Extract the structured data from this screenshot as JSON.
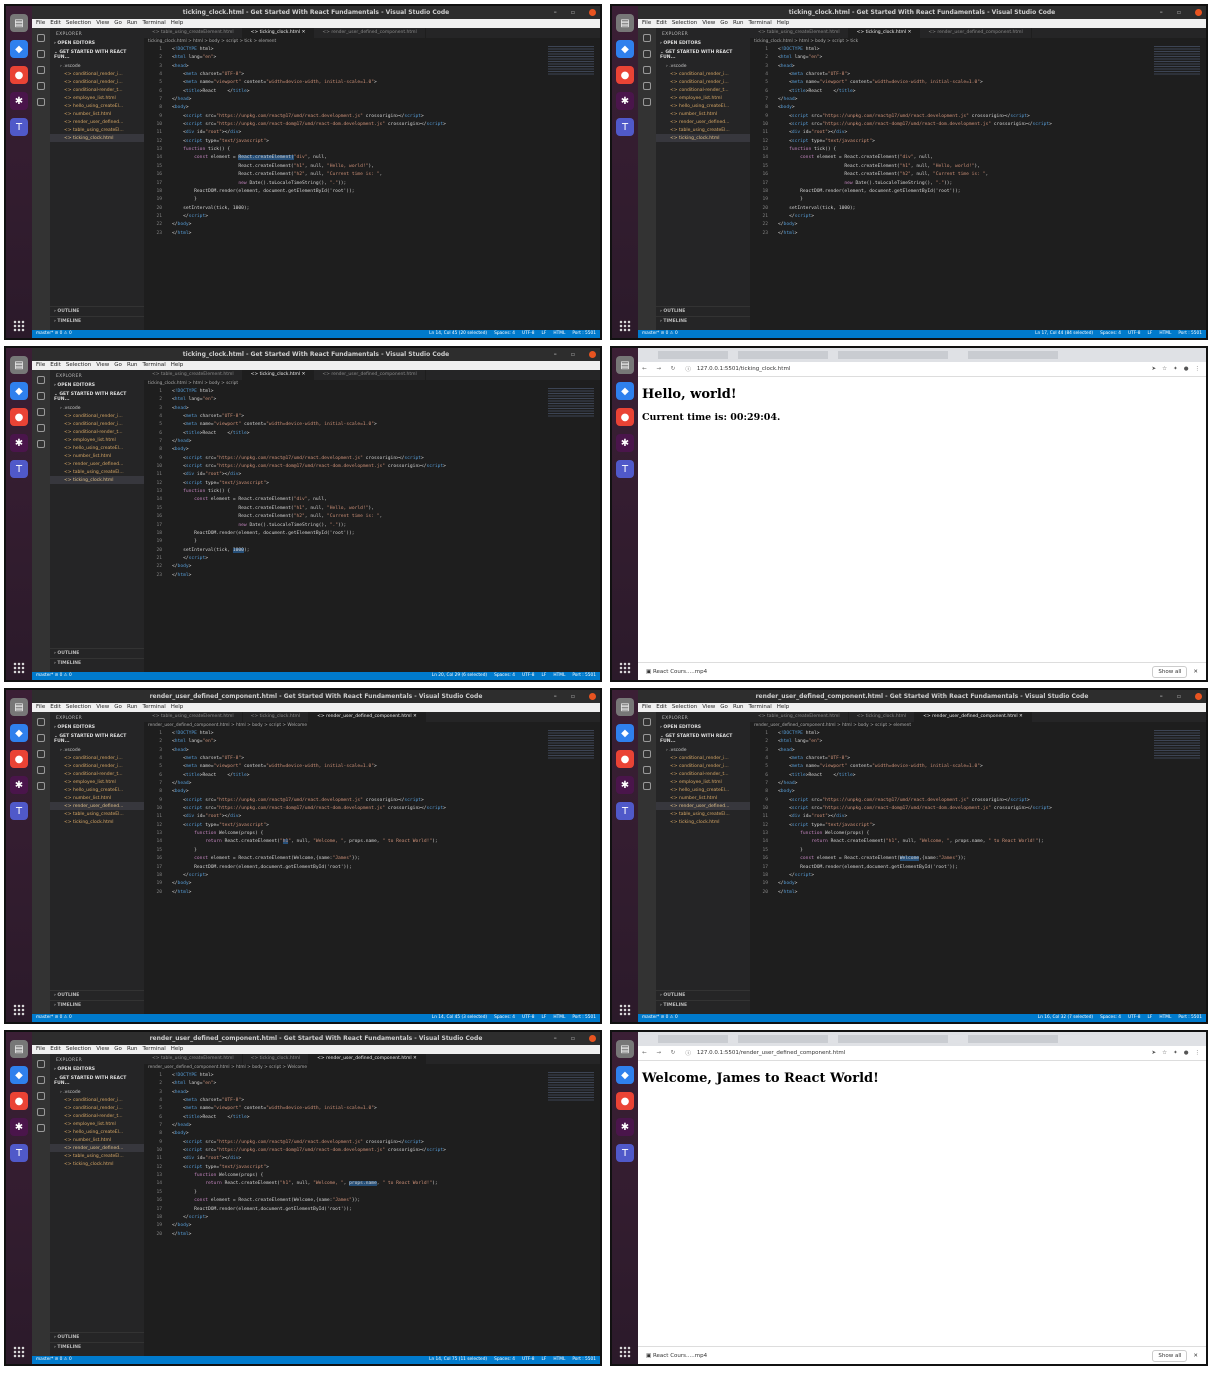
{
  "launcher_icons": [
    "files-icon",
    "vscode-icon",
    "chrome-icon",
    "slack-icon",
    "teams-icon"
  ],
  "vscode": {
    "menu": [
      "File",
      "Edit",
      "Selection",
      "View",
      "Go",
      "Run",
      "Terminal",
      "Help"
    ],
    "explorer_header": "EXPLORER",
    "open_editors": "OPEN EDITORS",
    "project": "GET STARTED WITH REACT FUN...",
    "folder": ".vscode",
    "files": [
      "conditional_render_i...",
      "conditional_render_i...",
      "conditional-render_t...",
      "employee_list.html",
      "hello_using_createEl...",
      "number_list.html",
      "render_user_defined...",
      "table_using_createEl...",
      "ticking_clock.html"
    ],
    "outline": "OUTLINE",
    "timeline": "TIMELINE",
    "tabs": [
      "table_using_createElement.html",
      "ticking_clock.html",
      "render_user_defined_component.html"
    ],
    "status_left": "master*  ⊘ 0 ⚠ 0",
    "status_right": [
      "Spaces: 4",
      "UTF-8",
      "LF",
      "HTML",
      "Port : 5501"
    ]
  },
  "panels": [
    {
      "title": "ticking_clock.html - Get Started With React Fundamentals - Visual Studio Code",
      "crumb": "ticking_clock.html > html > body > script > tick > element",
      "active_tab": 1,
      "sel_file": 8,
      "file": "clock",
      "cursor": "Ln 14, Col 45 (20 selected)"
    },
    {
      "title": "ticking_clock.html - Get Started With React Fundamentals - Visual Studio Code",
      "crumb": "ticking_clock.html > html > body > script > tick",
      "active_tab": 1,
      "sel_file": 8,
      "file": "clock",
      "cursor": "Ln 17, Col 44 (84 selected)"
    },
    {
      "title": "ticking_clock.html - Get Started With React Fundamentals - Visual Studio Code",
      "crumb": "ticking_clock.html > html > body > script",
      "active_tab": 1,
      "sel_file": 8,
      "file": "clock",
      "cursor": "Ln 20, Col 29 (6 selected)"
    },
    {
      "browser": true,
      "url": "127.0.0.1:5501/ticking_clock.html",
      "h1": "Hello, world!",
      "h2": "Current time is: 00:29:04.",
      "download": "React Cours.....mp4",
      "show_all": "Show all"
    },
    {
      "title": "render_user_defined_component.html - Get Started With React Fundamentals - Visual Studio Code",
      "crumb": "render_user_defined_component.html > html > body > script > Welcome",
      "active_tab": 2,
      "sel_file": 6,
      "file": "welcome",
      "cursor": "Ln 14, Col 45 (3 selected)"
    },
    {
      "title": "render_user_defined_component.html - Get Started With React Fundamentals - Visual Studio Code",
      "crumb": "render_user_defined_component.html > html > body > script > element",
      "active_tab": 2,
      "sel_file": 6,
      "file": "welcome",
      "cursor": "Ln 16, Col 32 (7 selected)"
    },
    {
      "title": "render_user_defined_component.html - Get Started With React Fundamentals - Visual Studio Code",
      "crumb": "render_user_defined_component.html > html > body > script > Welcome",
      "active_tab": 2,
      "sel_file": 6,
      "file": "welcome",
      "cursor": "Ln 14, Col 75 (11 selected)"
    },
    {
      "browser": true,
      "url": "127.0.0.1:5501/render_user_defined_component.html",
      "h1": "Welcome, James to React World!",
      "h2": "",
      "download": "React Cours.....mp4",
      "show_all": "Show all"
    }
  ]
}
